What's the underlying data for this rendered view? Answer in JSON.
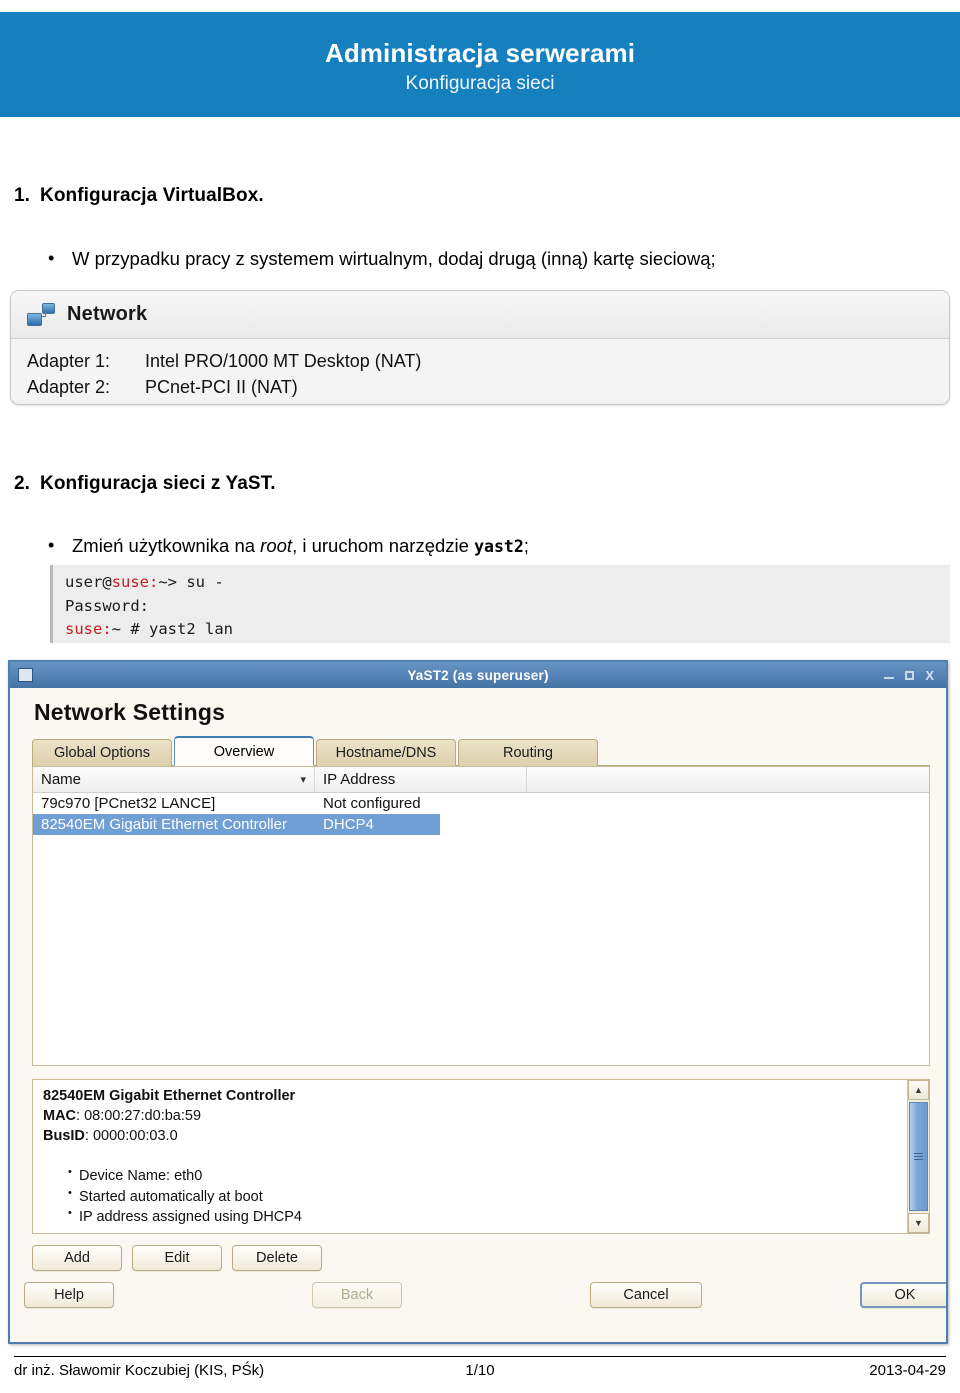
{
  "header": {
    "title": "Administracja serwerami",
    "subtitle": "Konfiguracja sieci",
    "bg_color": "#1680be"
  },
  "sections": [
    {
      "number": "1.",
      "heading": "Konfiguracja VirtualBox.",
      "bullet_prefix": "W przypadku pracy z systemem wirtualnym, dodaj drugą (inną) kartę sieciową;"
    },
    {
      "number": "2.",
      "heading": "Konfiguracja sieci z YaST.",
      "bullet_a": "Zmień użytkownika na ",
      "bullet_italic": "root",
      "bullet_b": ", i uruchom narzędzie ",
      "bullet_code": "yast2",
      "bullet_c": ";"
    }
  ],
  "vbox_panel": {
    "icon": "network-icon",
    "title": "Network",
    "adapters": [
      {
        "label": "Adapter 1:",
        "value": "Intel PRO/1000 MT Desktop (NAT)"
      },
      {
        "label": "Adapter 2:",
        "value": "PCnet-PCI II (NAT)"
      }
    ]
  },
  "terminal": {
    "line1_user": "user@",
    "line1_host": "suse:",
    "line1_rest": "~> su -",
    "line2": "Password:",
    "line3_host": "suse:",
    "line3_rest": "~ # yast2 lan",
    "host_color": "#c0201f"
  },
  "yast": {
    "window_title": "YaST2 (as superuser)",
    "window_controls": {
      "minimize": "minimize-icon",
      "maximize": "maximize-icon",
      "close": "X"
    },
    "page_title": "Network Settings",
    "tabs": [
      {
        "label": "Global Options",
        "mnemonic": "G",
        "active": false
      },
      {
        "label": "Overview",
        "mnemonic": "v",
        "active": true
      },
      {
        "label": "Hostname/DNS",
        "mnemonic": "s",
        "active": false
      },
      {
        "label": "Routing",
        "mnemonic": "u",
        "active": false
      }
    ],
    "table": {
      "columns": [
        "Name",
        "IP Address"
      ],
      "sort_indicator": "chevron-down-icon",
      "rows": [
        {
          "name": "79c970 [PCnet32 LANCE]",
          "ip": "Not configured",
          "selected": false
        },
        {
          "name": "82540EM Gigabit Ethernet Controller",
          "ip": "DHCP4",
          "selected": true
        }
      ]
    },
    "details": {
      "title": "82540EM Gigabit Ethernet Controller",
      "mac_label": "MAC",
      "mac_value": ": 08:00:27:d0:ba:59",
      "busid_label": "BusID",
      "busid_value": ": 0000:00:03.0",
      "items": [
        "Device Name: eth0",
        "Started automatically at boot",
        "IP address assigned using DHCP4"
      ]
    },
    "action_buttons": [
      {
        "label": "Add",
        "mnemonic": "A",
        "disabled": false
      },
      {
        "label": "Edit",
        "mnemonic": "i",
        "disabled": false
      },
      {
        "label": "Delete",
        "mnemonic": "e",
        "disabled": false
      }
    ],
    "footer_buttons": [
      {
        "label": "Help",
        "mnemonic": "H",
        "disabled": false
      },
      {
        "label": "Back",
        "mnemonic": "B",
        "disabled": true
      },
      {
        "label": "Cancel",
        "mnemonic": "C",
        "disabled": false
      },
      {
        "label": "OK",
        "mnemonic": "O",
        "disabled": false
      }
    ]
  },
  "page_footer": {
    "author": "dr inż. Sławomir Koczubiej (KIS, PŚk)",
    "page": "1/10",
    "date": "2013-04-29"
  }
}
